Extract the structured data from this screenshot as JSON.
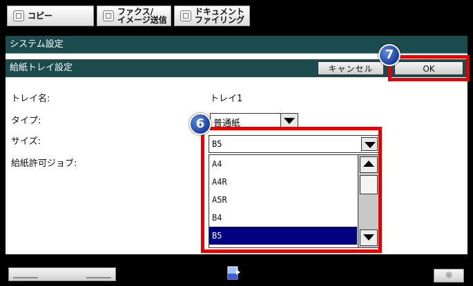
{
  "tabs": {
    "copy": "コピー",
    "fax": "ファクス/\nイメージ送信",
    "doc": "ドキュメント\nファイリング"
  },
  "header": {
    "system": "システム設定",
    "title": "給紙トレイ設定",
    "cancel": "キャンセル",
    "ok": "OK"
  },
  "form": {
    "tray_label": "トレイ名:",
    "tray_value": "トレイ1",
    "type_label": "タイプ:",
    "type_value": "普通紙",
    "size_label": "サイズ:",
    "size_value": "B5",
    "job_label": "給紙許可ジョブ:",
    "size_options": [
      "A4",
      "A4R",
      "A5R",
      "B4",
      "B5"
    ]
  },
  "callouts": {
    "step6": "6",
    "step7": "7"
  },
  "colors": {
    "header_bg": "#1c4b4e",
    "highlight": "#e30000",
    "selected": "#000080"
  },
  "icons": {
    "brightness": "☼"
  }
}
